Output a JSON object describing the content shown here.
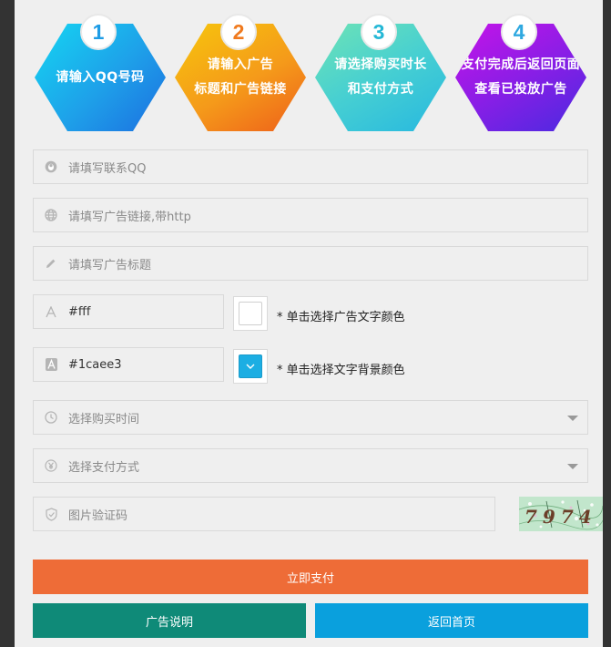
{
  "steps": [
    {
      "num": "1",
      "line1": "请输入QQ号码",
      "line2": "",
      "num_color": "#1e9ce5"
    },
    {
      "num": "2",
      "line1": "请输入广告",
      "line2": "标题和广告链接",
      "num_color": "#f07a1e"
    },
    {
      "num": "3",
      "line1": "请选择购买时长",
      "line2": "和支付方式",
      "num_color": "#25b8d6"
    },
    {
      "num": "4",
      "line1": "支付完成后返回页面",
      "line2": "查看已投放广告",
      "num_color": "#2ea8e0"
    }
  ],
  "form": {
    "qq_placeholder": "请填写联系QQ",
    "link_placeholder": "请填写广告链接,带http",
    "title_placeholder": "请填写广告标题",
    "text_color_value": "#fff",
    "text_color_hint": "* 单击选择广告文字颜色",
    "bg_color_value": "#1caee3",
    "bg_color_hint": "* 单击选择文字背景颜色",
    "duration_placeholder": "选择购买时间",
    "payment_placeholder": "选择支付方式",
    "captcha_placeholder": "图片验证码",
    "captcha_text": "7974"
  },
  "buttons": {
    "pay": "立即支付",
    "explain": "广告说明",
    "home": "返回首页"
  },
  "colors": {
    "pay": "#ee6c37",
    "explain": "#0f8a78",
    "home": "#0aa0dd",
    "text_swatch": "#ffffff",
    "bg_swatch": "#1caee3"
  },
  "icons": [
    "qq-icon",
    "globe-icon",
    "pencil-icon",
    "font-icon",
    "font-filled-icon",
    "clock-icon",
    "yen-icon",
    "shield-icon",
    "chevron-down-icon"
  ]
}
